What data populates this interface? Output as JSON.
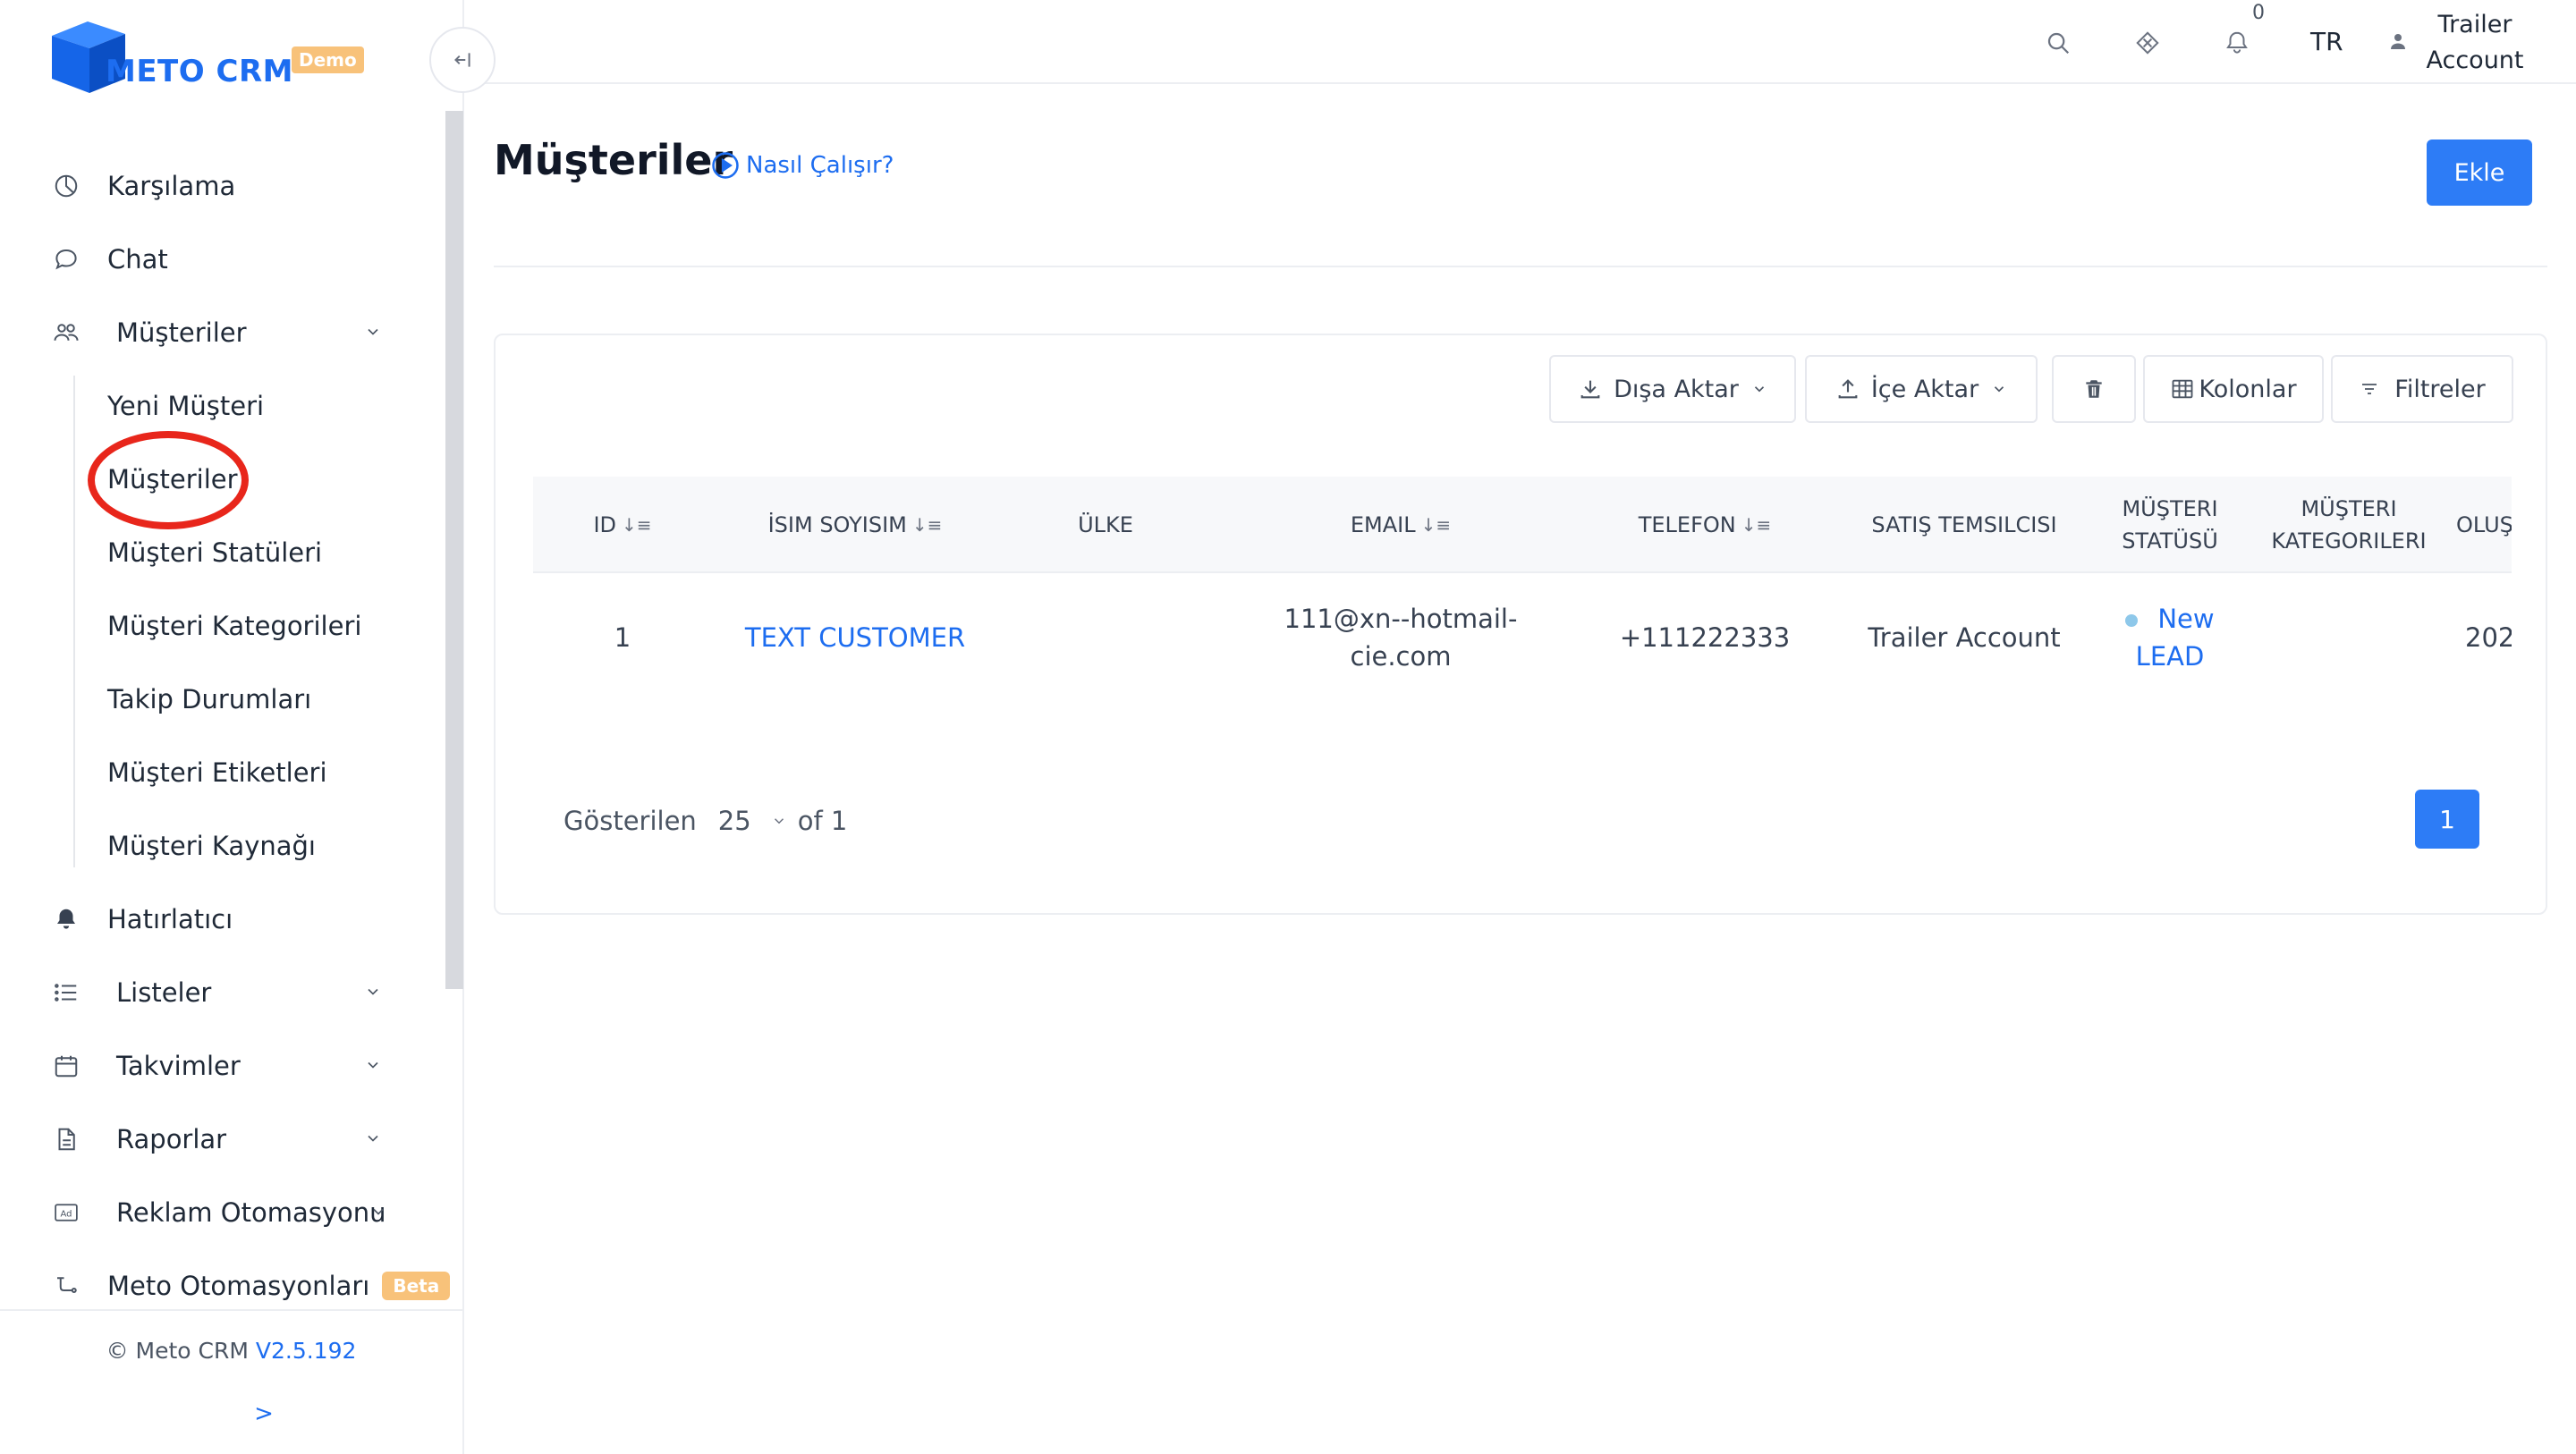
{
  "app": {
    "brand": "METO CRM",
    "badge": "Demo"
  },
  "sidebar": {
    "items": [
      {
        "label": "Karşılama",
        "icon": "dashboard-icon"
      },
      {
        "label": "Chat",
        "icon": "chat-icon"
      },
      {
        "label": "Müşteriler",
        "icon": "users-icon",
        "expanded": true,
        "children": [
          "Yeni Müşteri",
          "Müşteriler",
          "Müşteri Statüleri",
          "Müşteri Kategorileri",
          "Takip Durumları",
          "Müşteri Etiketleri",
          "Müşteri Kaynağı"
        ]
      },
      {
        "label": "Hatırlatıcı",
        "icon": "bell-icon"
      },
      {
        "label": "Listeler",
        "icon": "list-icon"
      },
      {
        "label": "Takvimler",
        "icon": "calendar-icon"
      },
      {
        "label": "Raporlar",
        "icon": "report-icon"
      },
      {
        "label": "Reklam Otomasyonu",
        "icon": "ad-icon"
      },
      {
        "label": "Meto Otomasyonları",
        "icon": "automation-icon",
        "badge": "Beta"
      }
    ],
    "active_child": "Müşteriler",
    "footer": {
      "copyright": "© Meto CRM",
      "version": "V2.5.192",
      "expand": ">"
    }
  },
  "topbar": {
    "notification_count": "0",
    "language": "TR",
    "account_line1": "Trailer",
    "account_line2": "Account"
  },
  "page": {
    "title": "Müşteriler",
    "help_link": "Nasıl Çalışır?",
    "add_button": "Ekle"
  },
  "toolbar": {
    "export": "Dışa Aktar",
    "import": "İçe Aktar",
    "columns": "Kolonlar",
    "filters": "Filtreler"
  },
  "table": {
    "headers": {
      "id": "ID",
      "name": "İSIM SOYISIM",
      "country": "ÜLKE",
      "email": "EMAIL",
      "phone": "TELEFON",
      "rep": "SATIŞ TEMSILCISI",
      "status_1": "MÜŞTERI",
      "status_2": "STATÜSÜ",
      "cat_1": "MÜŞTERI",
      "cat_2": "KATEGORILERI",
      "created": "OLUŞTU"
    },
    "rows": [
      {
        "id": "1",
        "name": "TEXT CUSTOMER",
        "country": "",
        "email_1": "111@xn--hotmail-",
        "email_2": "cie.com",
        "phone": "+111222333",
        "rep": "Trailer Account",
        "status_1": "New",
        "status_2": "LEAD",
        "category": "",
        "created": "202"
      }
    ]
  },
  "pagination": {
    "shown_label": "Gösterilen",
    "page_size": "25",
    "of_label": "of 1",
    "current_page": "1"
  },
  "colors": {
    "accent": "#2d7cf6",
    "brand_blue": "#1d6df0",
    "badge_orange": "#f8c27a",
    "highlight_ring": "#e8261b"
  }
}
